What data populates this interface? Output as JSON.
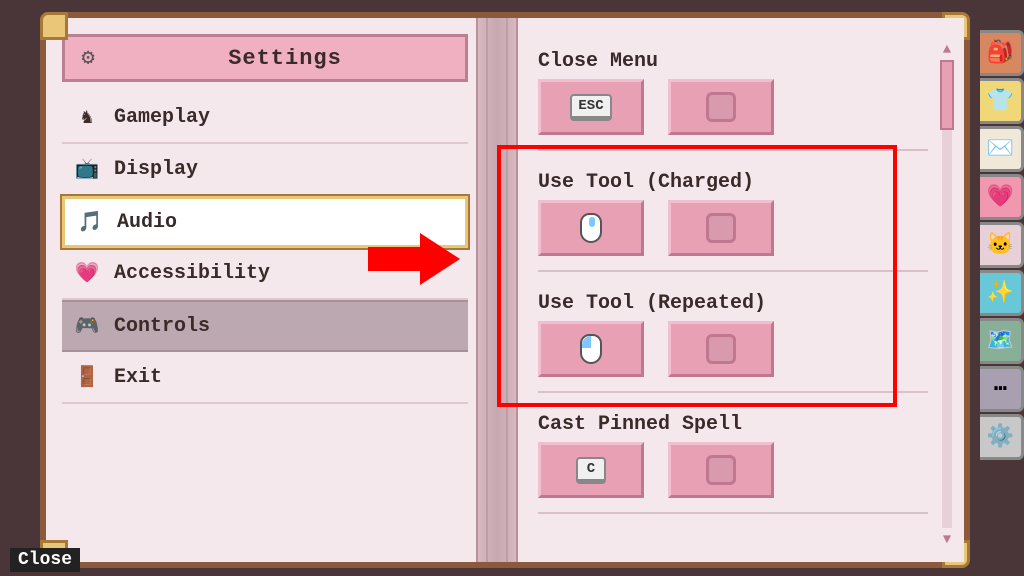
{
  "header": {
    "title": "Settings"
  },
  "menu": {
    "items": [
      {
        "label": "Gameplay",
        "icon_name": "knight-icon"
      },
      {
        "label": "Display",
        "icon_name": "tv-icon"
      },
      {
        "label": "Audio",
        "icon_name": "music-icon",
        "hovered": true
      },
      {
        "label": "Accessibility",
        "icon_name": "heart-icon"
      },
      {
        "label": "Controls",
        "icon_name": "gamepad-icon",
        "selected": true
      },
      {
        "label": "Exit",
        "icon_name": "door-icon"
      }
    ]
  },
  "bindings": [
    {
      "label": "Close Menu",
      "primary": {
        "type": "key",
        "value": "ESC"
      },
      "secondary": {
        "type": "empty"
      }
    },
    {
      "label": "Use Tool (Charged)",
      "primary": {
        "type": "mouse",
        "value": "hold"
      },
      "secondary": {
        "type": "empty"
      }
    },
    {
      "label": "Use Tool (Repeated)",
      "primary": {
        "type": "mouse",
        "value": "left"
      },
      "secondary": {
        "type": "empty"
      }
    },
    {
      "label": "Cast Pinned Spell",
      "primary": {
        "type": "key",
        "value": "C"
      },
      "secondary": {
        "type": "empty"
      }
    }
  ],
  "tabs": [
    {
      "name": "inventory-tab",
      "color": "#d88860"
    },
    {
      "name": "clothing-tab",
      "color": "#f0d878"
    },
    {
      "name": "mail-tab",
      "color": "#f0e8d8"
    },
    {
      "name": "social-tab",
      "color": "#f098b0"
    },
    {
      "name": "pets-tab",
      "color": "#e8d0d8"
    },
    {
      "name": "skills-tab",
      "color": "#68c8d8"
    },
    {
      "name": "map-tab",
      "color": "#88b098"
    },
    {
      "name": "menu-tab",
      "color": "#a8a0b0"
    },
    {
      "name": "settings-tab",
      "color": "#c8c8c8"
    }
  ],
  "tab_icons": [
    "🎒",
    "👕",
    "✉️",
    "💗",
    "🐱",
    "✨",
    "🗺️",
    "⋯",
    "⚙️"
  ],
  "close_label": "Close",
  "highlight": {
    "indices": [
      1,
      2
    ]
  }
}
